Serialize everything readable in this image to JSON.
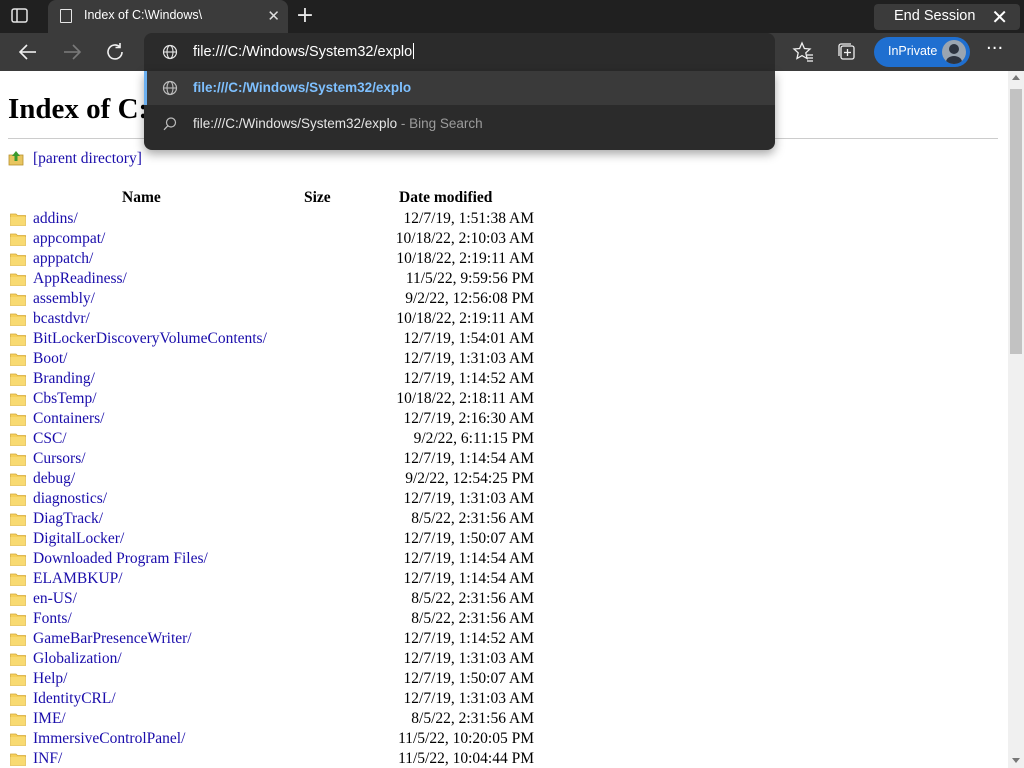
{
  "browser": {
    "tab_title": "Index of C:\\Windows\\",
    "end_session_label": "End Session",
    "address_text": "file:///C:/Windows/System32/explo",
    "inprivate_label": "InPrivate"
  },
  "suggestions": [
    {
      "text": "file:///C:/Windows/System32/explo",
      "hint": "",
      "icon": "globe-icon",
      "selected": true
    },
    {
      "text": "file:///C:/Windows/System32/explo",
      "hint": " - Bing Search",
      "icon": "search-icon",
      "selected": false
    }
  ],
  "page": {
    "heading": "Index of C:\\Windows\\",
    "parent_link": "[parent directory]",
    "columns": {
      "name": "Name",
      "size": "Size",
      "date": "Date modified"
    }
  },
  "files": [
    {
      "name": "addins/",
      "date": "12/7/19, 1:51:38 AM"
    },
    {
      "name": "appcompat/",
      "date": "10/18/22, 2:10:03 AM"
    },
    {
      "name": "apppatch/",
      "date": "10/18/22, 2:19:11 AM"
    },
    {
      "name": "AppReadiness/",
      "date": "11/5/22, 9:59:56 PM"
    },
    {
      "name": "assembly/",
      "date": "9/2/22, 12:56:08 PM"
    },
    {
      "name": "bcastdvr/",
      "date": "10/18/22, 2:19:11 AM"
    },
    {
      "name": "BitLockerDiscoveryVolumeContents/",
      "date": "12/7/19, 1:54:01 AM"
    },
    {
      "name": "Boot/",
      "date": "12/7/19, 1:31:03 AM"
    },
    {
      "name": "Branding/",
      "date": "12/7/19, 1:14:52 AM"
    },
    {
      "name": "CbsTemp/",
      "date": "10/18/22, 2:18:11 AM"
    },
    {
      "name": "Containers/",
      "date": "12/7/19, 2:16:30 AM"
    },
    {
      "name": "CSC/",
      "date": "9/2/22, 6:11:15 PM"
    },
    {
      "name": "Cursors/",
      "date": "12/7/19, 1:14:54 AM"
    },
    {
      "name": "debug/",
      "date": "9/2/22, 12:54:25 PM"
    },
    {
      "name": "diagnostics/",
      "date": "12/7/19, 1:31:03 AM"
    },
    {
      "name": "DiagTrack/",
      "date": "8/5/22, 2:31:56 AM"
    },
    {
      "name": "DigitalLocker/",
      "date": "12/7/19, 1:50:07 AM"
    },
    {
      "name": "Downloaded Program Files/",
      "date": "12/7/19, 1:14:54 AM"
    },
    {
      "name": "ELAMBKUP/",
      "date": "12/7/19, 1:14:54 AM"
    },
    {
      "name": "en-US/",
      "date": "8/5/22, 2:31:56 AM"
    },
    {
      "name": "Fonts/",
      "date": "8/5/22, 2:31:56 AM"
    },
    {
      "name": "GameBarPresenceWriter/",
      "date": "12/7/19, 1:14:52 AM"
    },
    {
      "name": "Globalization/",
      "date": "12/7/19, 1:31:03 AM"
    },
    {
      "name": "Help/",
      "date": "12/7/19, 1:50:07 AM"
    },
    {
      "name": "IdentityCRL/",
      "date": "12/7/19, 1:31:03 AM"
    },
    {
      "name": "IME/",
      "date": "8/5/22, 2:31:56 AM"
    },
    {
      "name": "ImmersiveControlPanel/",
      "date": "11/5/22, 10:20:05 PM"
    },
    {
      "name": "INF/",
      "date": "11/5/22, 10:04:44 PM"
    }
  ],
  "colors": {
    "tab_strip": "#202020",
    "toolbar": "#3b3b3b",
    "inprivate": "#1f6fd0",
    "link": "#1a0dab",
    "suggestion_highlight": "#7ec0ff"
  }
}
